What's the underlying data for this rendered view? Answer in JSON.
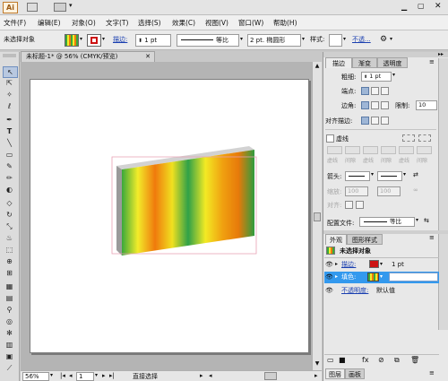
{
  "app": {
    "logo": "Ai"
  },
  "menu": [
    "文件(F)",
    "编辑(E)",
    "对象(O)",
    "文字(T)",
    "选择(S)",
    "效果(C)",
    "视图(V)",
    "窗口(W)",
    "帮助(H)"
  ],
  "control": {
    "selection": "未选择对象",
    "stroke_link": "描边:",
    "stroke_weight": "1 pt",
    "uniform": "等比",
    "profile": "2 pt. 椭圆形",
    "style_label": "样式:",
    "opacity_link": "不透...",
    "fill_color": "#ffd000",
    "stroke_color": "#cc1111"
  },
  "document": {
    "tab_title": "未标题-1* @ 56% (CMYK/预览)"
  },
  "status": {
    "zoom": "56%",
    "page": "1",
    "tool": "直接选择"
  },
  "stroke_panel": {
    "tabs": [
      "描边",
      "渐变",
      "透明度"
    ],
    "weight_label": "粗细:",
    "weight_value": "1 pt",
    "cap_label": "端点:",
    "corner_label": "边角:",
    "limit_label": "限制:",
    "limit_value": "10",
    "align_label": "对齐描边:",
    "dashed_label": "虚线",
    "dash_labels": [
      "虚线",
      "间隙",
      "虚线",
      "间隙",
      "虚线",
      "间隙"
    ],
    "arrow_label": "箭头:",
    "scale_label": "缩放:",
    "scale_value_1": "100",
    "scale_value_2": "100",
    "align_arrow_label": "对齐:",
    "profile_label": "配置文件:",
    "profile_value": "等比"
  },
  "appearance_panel": {
    "tabs": [
      "外观",
      "图形样式"
    ],
    "title": "未选择对象",
    "stroke_label": "描边:",
    "stroke_value": "1 pt",
    "fill_label": "填色:",
    "opacity_label": "不透明度:",
    "opacity_value": "默认值",
    "stroke_color": "#cc1111"
  },
  "bottom_tabs": [
    "图层",
    "画板"
  ],
  "colors": {
    "gradient": [
      "#3aa83a",
      "#f2ec2a",
      "#f07a0c",
      "#f0e020",
      "#2fa148",
      "#f3ea24",
      "#f0a010",
      "#e77a0a",
      "#2e9c3e"
    ]
  }
}
